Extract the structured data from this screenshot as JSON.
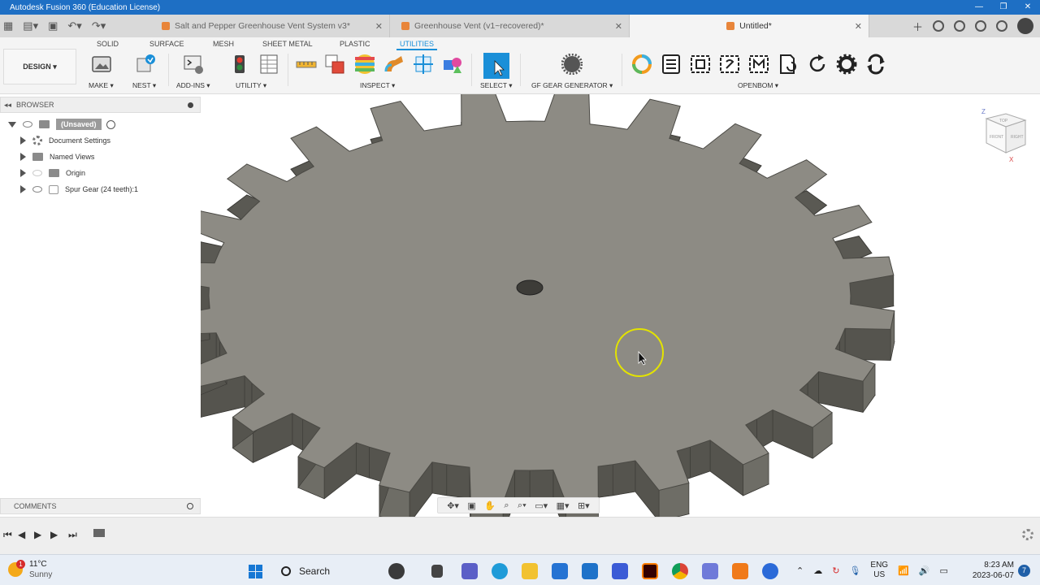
{
  "window": {
    "title": "Autodesk Fusion 360 (Education License)"
  },
  "tabs": [
    {
      "label": "Salt and Pepper Greenhouse Vent System v3*",
      "active": false
    },
    {
      "label": "Greenhouse Vent (v1~recovered)*",
      "active": false
    },
    {
      "label": "Untitled*",
      "active": true
    }
  ],
  "ribbon": {
    "workspace": "DESIGN ▾",
    "tabs": [
      "SOLID",
      "SURFACE",
      "MESH",
      "SHEET METAL",
      "PLASTIC",
      "UTILITIES"
    ],
    "active_tab": "UTILITIES",
    "groups": {
      "make": "MAKE ▾",
      "nest": "NEST ▾",
      "addins": "ADD-INS ▾",
      "utility": "UTILITY ▾",
      "inspect": "INSPECT ▾",
      "select": "SELECT ▾",
      "gear_generator": "GF GEAR GENERATOR ▾",
      "openbom": "OPENBOM ▾"
    }
  },
  "browser": {
    "header": "BROWSER",
    "root": "(Unsaved)",
    "items": [
      {
        "label": "Document Settings"
      },
      {
        "label": "Named Views"
      },
      {
        "label": "Origin"
      },
      {
        "label": "Spur Gear (24 teeth):1"
      }
    ]
  },
  "comments": {
    "header": "COMMENTS"
  },
  "viewcube": {
    "axis_z": "Z",
    "axis_x": "X",
    "faces": [
      "TOP",
      "FRONT",
      "RIGHT"
    ]
  },
  "taskbar": {
    "weather_temp": "11°C",
    "weather_desc": "Sunny",
    "weather_badge": "1",
    "search_label": "Search",
    "lang_top": "ENG",
    "lang_bottom": "US",
    "time": "8:23 AM",
    "date": "2023-06-07",
    "notification_count": "7"
  },
  "colors": {
    "titlebar": "#1e6fc4",
    "accent": "#1a8fd8",
    "gear_face": "#8d8b84",
    "gear_side": "#5a5953",
    "cursor_ring": "#e3e300"
  }
}
